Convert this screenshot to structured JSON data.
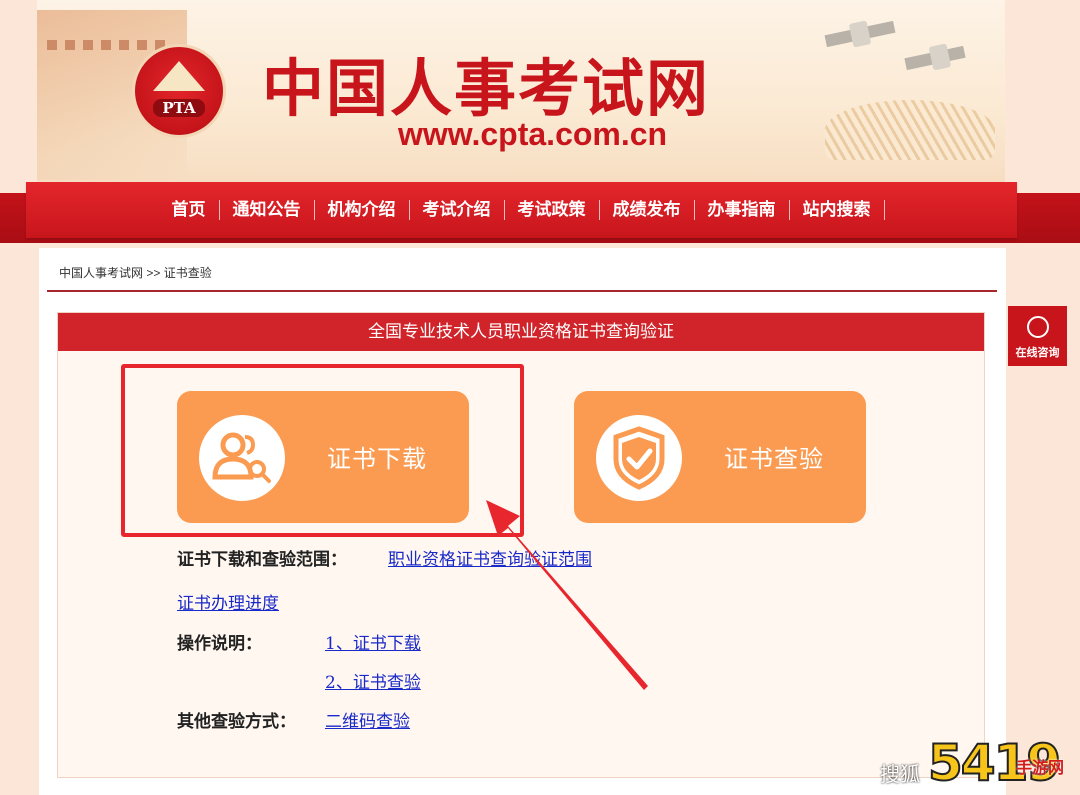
{
  "header": {
    "logo_text": "PTA",
    "site_title": "中国人事考试网",
    "site_url": "www.cpta.com.cn"
  },
  "nav": {
    "items": [
      "首页",
      "通知公告",
      "机构介绍",
      "考试介绍",
      "考试政策",
      "成绩发布",
      "办事指南",
      "站内搜索"
    ]
  },
  "breadcrumb": {
    "home": "中国人事考试网",
    "separator": ">>",
    "current": "证书查验"
  },
  "panel": {
    "title": "全国专业技术人员职业资格证书查询验证",
    "cards": [
      {
        "label": "证书下载",
        "icon": "user-search-icon"
      },
      {
        "label": "证书查验",
        "icon": "shield-check-icon"
      }
    ],
    "scope_label": "证书下载和查验范围：",
    "scope_link": "职业资格证书查询验证范围",
    "progress_link": "证书办理进度",
    "instructions_label": "操作说明：",
    "instruction_links": [
      "1、证书下载",
      "2、证书查验"
    ],
    "other_label": "其他查验方式：",
    "other_link": "二维码查验"
  },
  "side": {
    "consult_label": "在线咨询"
  },
  "watermark": {
    "text": "搜狐",
    "logo_number": "5419",
    "logo_text": "手游网"
  },
  "colors": {
    "brand_red": "#c8151c",
    "card_orange": "#fb9b52",
    "link_blue": "#1a2ac9",
    "highlight_red": "#e8262d"
  }
}
